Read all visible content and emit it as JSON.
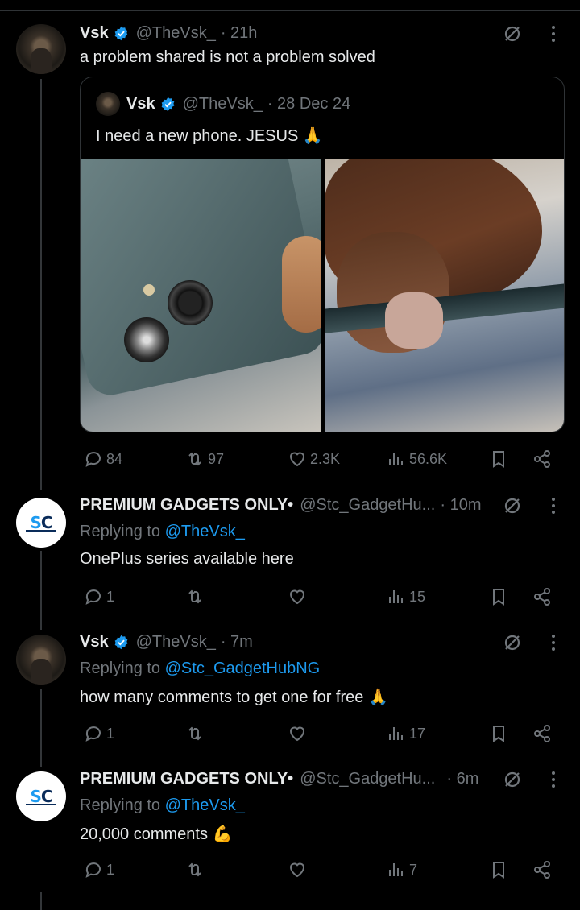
{
  "post_main": {
    "name": "Vsk",
    "handle": "@TheVsk_",
    "time": "· 21h",
    "text": "a problem shared is not a problem solved",
    "quote": {
      "name": "Vsk",
      "handle": "@TheVsk_",
      "time": "· 28 Dec 24",
      "text": "I need a new phone. JESUS 🙏"
    },
    "stats": {
      "replies": "84",
      "reposts": "97",
      "likes": "2.3K",
      "views": "56.6K"
    }
  },
  "reply1": {
    "name": "PREMIUM GADGETS ONLY•",
    "handle": "@Stc_GadgetHu...",
    "time": "· 10m",
    "replying_prefix": "Replying to ",
    "replying_to": "@TheVsk_",
    "text": "OnePlus series available here",
    "stats": {
      "replies": "1",
      "views": "15"
    }
  },
  "reply2": {
    "name": "Vsk",
    "handle": "@TheVsk_",
    "time": "· 7m",
    "replying_prefix": "Replying to ",
    "replying_to": "@Stc_GadgetHubNG",
    "text": "how many comments to get one for free 🙏",
    "stats": {
      "replies": "1",
      "views": "17"
    }
  },
  "reply3": {
    "name": "PREMIUM GADGETS ONLY•",
    "handle": "@Stc_GadgetHu...",
    "time": "· 6m",
    "replying_prefix": "Replying to ",
    "replying_to": "@TheVsk_",
    "text": "20,000 comments 💪",
    "stats": {
      "replies": "1",
      "views": "7"
    }
  },
  "logo": {
    "mark_a": "S",
    "mark_b": "C"
  },
  "colors": {
    "background": "#000000",
    "text": "#e7e9ea",
    "muted": "#71767b",
    "accent": "#1d9bf0",
    "border": "#2f3336"
  }
}
